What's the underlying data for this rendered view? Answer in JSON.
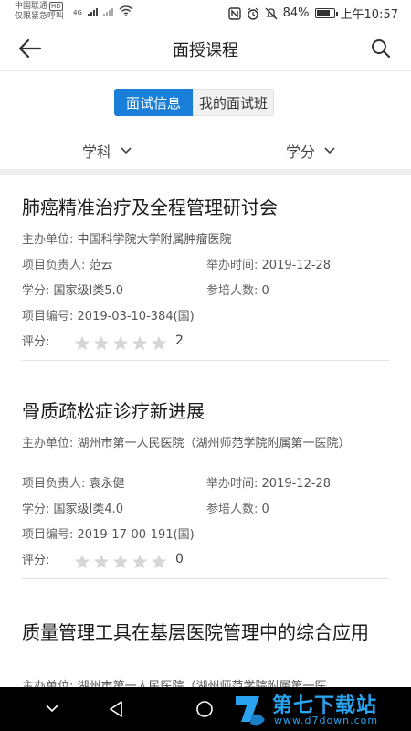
{
  "status_bar": {
    "carrier_line1": "中国联通",
    "carrier_hd": "HD",
    "carrier_line2": "仅限紧急呼叫",
    "network": "4G",
    "battery_percent": "84%",
    "time": "上午10:57",
    "battery_level": 0.84
  },
  "nav": {
    "title": "面授课程",
    "back_icon": "arrow-left-icon",
    "search_icon": "search-icon"
  },
  "tabs": {
    "active": "面试信息",
    "inactive": "我的面试班"
  },
  "filters": {
    "subject": "学科",
    "credit": "学分"
  },
  "courses": [
    {
      "title": "肺癌精准治疗及全程管理研讨会",
      "organizer_label": "主办单位:",
      "organizer": "中国科学院大学附属肿瘤医院",
      "leader_label": "项目负责人:",
      "leader": "范云",
      "date_label": "举办时间:",
      "date": "2019-12-28",
      "credit_label": "学分:",
      "credit": "国家级I类5.0",
      "trainees_label": "参培人数:",
      "trainees": "0",
      "code_label": "项目编号:",
      "code": "2019-03-10-384(国)",
      "rating_label": "评分:",
      "rating_count": "2",
      "rating": 0
    },
    {
      "title": "骨质疏松症诊疗新进展",
      "organizer_label": "主办单位:",
      "organizer": "湖州市第一人民医院（湖州师范学院附属第一医院）",
      "leader_label": "项目负责人:",
      "leader": "袁永健",
      "date_label": "举办时间:",
      "date": "2019-12-28",
      "credit_label": "学分:",
      "credit": "国家级I类4.0",
      "trainees_label": "参培人数:",
      "trainees": "0",
      "code_label": "项目编号:",
      "code": "2019-17-00-191(国)",
      "rating_label": "评分:",
      "rating_count": "0",
      "rating": 0
    },
    {
      "title": "质量管理工具在基层医院管理中的综合应用",
      "organizer_label": "主办单位:",
      "organizer": "湖州市第一人民医院（湖州师范学院附属第一医"
    }
  ],
  "watermark": {
    "name": "第七下载站",
    "url": "www.d7down.com"
  },
  "colors": {
    "accent": "#1a7fd8",
    "star_empty": "#d6d6d6",
    "watermark": "#29a3f0"
  }
}
